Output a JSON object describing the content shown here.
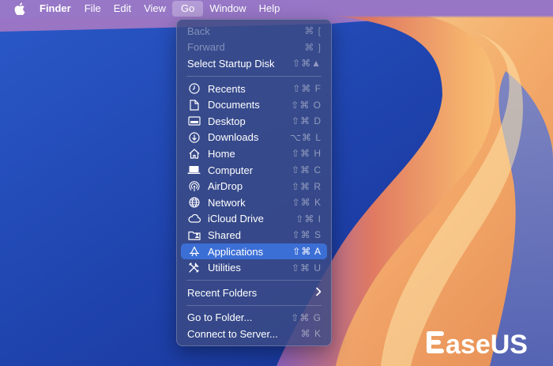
{
  "menubar": {
    "app_name": "Finder",
    "items": [
      "File",
      "Edit",
      "View",
      "Go",
      "Window",
      "Help"
    ]
  },
  "go_menu": {
    "nav": [
      {
        "label": "Back",
        "shortcut": "⌘ [",
        "disabled": true
      },
      {
        "label": "Forward",
        "shortcut": "⌘ ]",
        "disabled": true
      },
      {
        "label": "Select Startup Disk",
        "shortcut": "⇧⌘▲",
        "disabled": false
      }
    ],
    "places": [
      {
        "label": "Recents",
        "shortcut": "⇧⌘ F",
        "icon": "clock-icon"
      },
      {
        "label": "Documents",
        "shortcut": "⇧⌘ O",
        "icon": "document-icon"
      },
      {
        "label": "Desktop",
        "shortcut": "⇧⌘ D",
        "icon": "desktop-icon"
      },
      {
        "label": "Downloads",
        "shortcut": "⌥⌘ L",
        "icon": "download-icon"
      },
      {
        "label": "Home",
        "shortcut": "⇧⌘ H",
        "icon": "home-icon"
      },
      {
        "label": "Computer",
        "shortcut": "⇧⌘ C",
        "icon": "laptop-icon"
      },
      {
        "label": "AirDrop",
        "shortcut": "⇧⌘ R",
        "icon": "airdrop-icon"
      },
      {
        "label": "Network",
        "shortcut": "⇧⌘ K",
        "icon": "globe-icon"
      },
      {
        "label": "iCloud Drive",
        "shortcut": "⇧⌘ I",
        "icon": "cloud-icon"
      },
      {
        "label": "Shared",
        "shortcut": "⇧⌘ S",
        "icon": "shared-folder-icon"
      },
      {
        "label": "Applications",
        "shortcut": "⇧⌘ A",
        "icon": "applications-icon",
        "selected": true
      },
      {
        "label": "Utilities",
        "shortcut": "⇧⌘ U",
        "icon": "utilities-icon"
      }
    ],
    "recent_folders": {
      "label": "Recent Folders"
    },
    "folder_actions": [
      {
        "label": "Go to Folder...",
        "shortcut": "⇧⌘ G"
      },
      {
        "label": "Connect to Server...",
        "shortcut": "⌘ K"
      }
    ]
  },
  "watermark": {
    "text": "EaseUS"
  },
  "colors": {
    "selection": "#3c6fd6",
    "menu_bg": "#3c4b82",
    "wallpaper_blue": "#2346b0",
    "wallpaper_orange": "#f0a060"
  }
}
